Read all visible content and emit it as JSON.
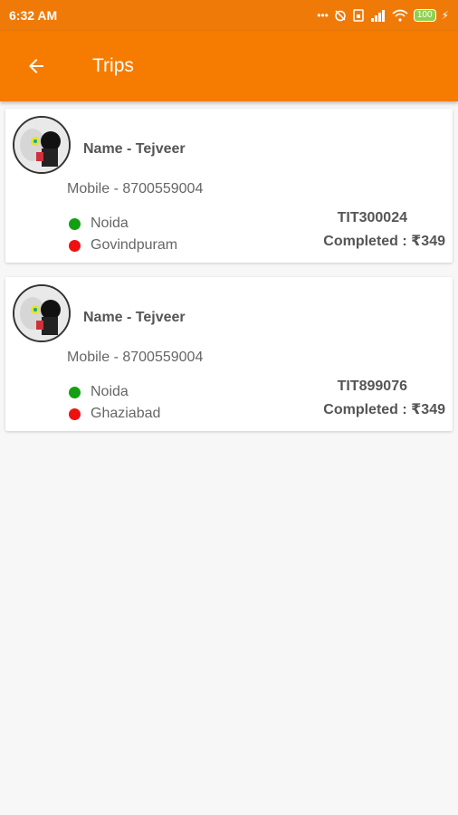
{
  "status_bar": {
    "time": "6:32 AM",
    "icons": [
      "more-icon",
      "alarm-off-icon",
      "sim-icon",
      "signal-icon",
      "wifi-icon"
    ],
    "battery": "100"
  },
  "app_bar": {
    "title": "Trips",
    "back_icon": "arrow-left-icon"
  },
  "colors": {
    "primary": "#f57c00",
    "status_bar": "#f07a08",
    "pickup_dot": "#12a012",
    "drop_dot": "#ee1111"
  },
  "trips": [
    {
      "name": "Name - Tejveer",
      "mobile": "Mobile - 8700559004",
      "pickup": "Noida",
      "drop": "Govindpuram",
      "trip_id": "TIT300024",
      "status": "Completed : ₹349"
    },
    {
      "name": "Name - Tejveer",
      "mobile": "Mobile - 8700559004",
      "pickup": "Noida",
      "drop": "Ghaziabad",
      "trip_id": "TIT899076",
      "status": "Completed : ₹349"
    }
  ]
}
